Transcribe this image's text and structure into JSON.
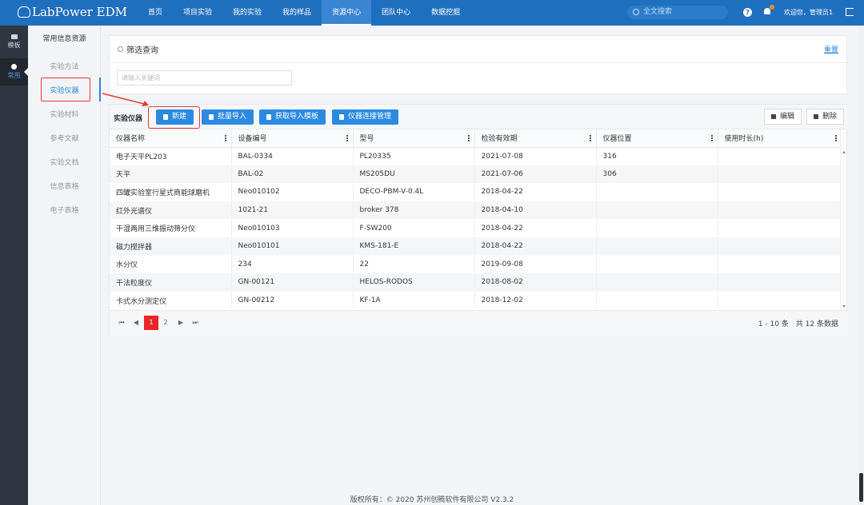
{
  "app": {
    "title": "LabPower EDM"
  },
  "nav": [
    "首页",
    "项目实验",
    "我的实验",
    "我的样品",
    "资源中心",
    "团队中心",
    "数据挖掘"
  ],
  "search": {
    "placeholder": "全文搜索"
  },
  "user": {
    "welcome": "欢迎您，管理员1"
  },
  "rail": {
    "items": [
      "模板",
      "常用"
    ]
  },
  "subnav": {
    "title": "常用信息资源",
    "items": [
      "实验方法",
      "实验仪器",
      "实验材料",
      "参考文献",
      "实验文档",
      "信息表格",
      "电子表格"
    ]
  },
  "filter": {
    "title": "筛选查询",
    "reset": "重置",
    "keyword_placeholder": "请输入关键词"
  },
  "toolbar": {
    "title": "实验仪器",
    "new": "新建",
    "batch_import": "批量导入",
    "get_template": "获取导入模板",
    "connect_manage": "仪器连接管理",
    "edit": "编辑",
    "delete": "删除"
  },
  "table": {
    "columns": [
      "仪器名称",
      "设备编号",
      "型号",
      "检验有效期",
      "仪器位置",
      "使用时长(h)"
    ],
    "rows": [
      [
        "电子天平PL203",
        "BAL-0334",
        "PL20335",
        "2021-07-08",
        "316",
        ""
      ],
      [
        "天平",
        "BAL-02",
        "MS205DU",
        "2021-07-06",
        "306",
        ""
      ],
      [
        "四罐实验室行星式商能球磨机",
        "Neo010102",
        "DECO-PBM-V-0.4L",
        "2018-04-22",
        "",
        ""
      ],
      [
        "红外光谱仪",
        "1021-21",
        "broker 378",
        "2018-04-10",
        "",
        ""
      ],
      [
        "干湿两用三维振动筛分仪",
        "Neo010103",
        "F-SW200",
        "2018-04-22",
        "",
        ""
      ],
      [
        "磁力搅拌器",
        "Neo010101",
        "KMS-181-E",
        "2018-04-22",
        "",
        ""
      ],
      [
        "水分仪",
        "234",
        "22",
        "2019-09-08",
        "",
        ""
      ],
      [
        "干法粒度仪",
        "GN-00121",
        "HELOS-RODOS",
        "2018-08-02",
        "",
        ""
      ],
      [
        "卡式水分测定仪",
        "GN-00212",
        "KF-1A",
        "2018-12-02",
        "",
        ""
      ]
    ]
  },
  "pager": {
    "pages": [
      "1",
      "2"
    ],
    "current": "1",
    "info": "1 - 10 条　共 12 条数据"
  },
  "footer": {
    "text": "版权所有：© 2020 苏州创腾软件有限公司   V2.3.2"
  },
  "colors": {
    "brand": "#1f6fbf",
    "button": "#2b8ae0",
    "highlight": "#e53935",
    "link": "#2b86d8"
  }
}
